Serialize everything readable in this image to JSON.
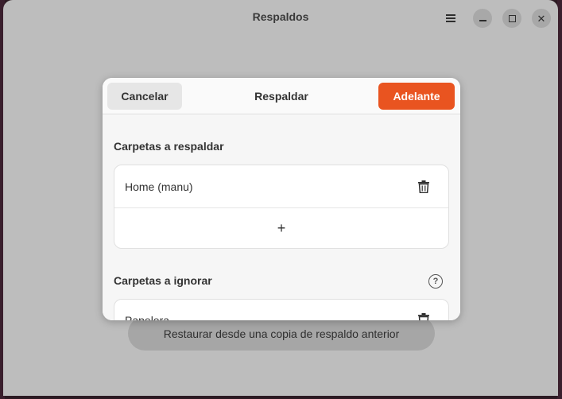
{
  "window": {
    "title": "Respaldos",
    "restore_label": "Restaurar desde una copia de respaldo anterior"
  },
  "headerbar": {
    "menu_icon": "hamburger-menu-icon",
    "min_icon": "minimize-icon",
    "max_icon": "maximize-icon",
    "close_icon": "close-icon",
    "close_glyph": "✕"
  },
  "dialog": {
    "title": "Respaldar",
    "cancel_label": "Cancelar",
    "next_label": "Adelante",
    "accent_color": "#e95420",
    "sections": {
      "include": {
        "title": "Carpetas a respaldar",
        "items": [
          {
            "label": "Home (manu)"
          }
        ],
        "add_glyph": "+"
      },
      "exclude": {
        "title": "Carpetas a ignorar",
        "help_glyph": "?",
        "items": [
          {
            "label": "Papelera"
          }
        ]
      }
    }
  }
}
